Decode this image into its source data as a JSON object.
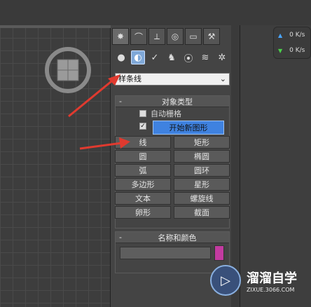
{
  "tabs": [
    {
      "icon": "sun-icon",
      "glyph": "✸"
    },
    {
      "icon": "curve-icon",
      "glyph": "⌒"
    },
    {
      "icon": "hierarchy-icon",
      "glyph": "⟂"
    },
    {
      "icon": "motion-icon",
      "glyph": "◎"
    },
    {
      "icon": "display-icon",
      "glyph": "▭"
    },
    {
      "icon": "hammer-icon",
      "glyph": "⚒"
    }
  ],
  "subtabs": [
    {
      "icon": "sphere-icon",
      "glyph": "●"
    },
    {
      "icon": "shapes-icon",
      "glyph": "◐"
    },
    {
      "icon": "light-icon",
      "glyph": "✓"
    },
    {
      "icon": "camera-icon",
      "glyph": "♞"
    },
    {
      "icon": "helper-icon",
      "glyph": "⦿"
    },
    {
      "icon": "spacewarp-icon",
      "glyph": "≋"
    },
    {
      "icon": "systems-icon",
      "glyph": "✲"
    }
  ],
  "dropdown": {
    "value": "样条线"
  },
  "object_type": {
    "title": "对象类型",
    "autogrid": "自动栅格",
    "start_new_shape": "开始新图形",
    "buttons": [
      "线",
      "矩形",
      "圆",
      "椭圆",
      "弧",
      "圆环",
      "多边形",
      "星形",
      "文本",
      "螺旋线",
      "卵形",
      "截面"
    ]
  },
  "name_color": {
    "title": "名称和颜色",
    "swatch_color": "#c23ba0"
  },
  "net": {
    "up": "0 K/s",
    "down": "0 K/s"
  },
  "watermark": {
    "brand": "溜溜自学",
    "url": "ZIXUE.3066.COM"
  },
  "rollout_minus": "-"
}
